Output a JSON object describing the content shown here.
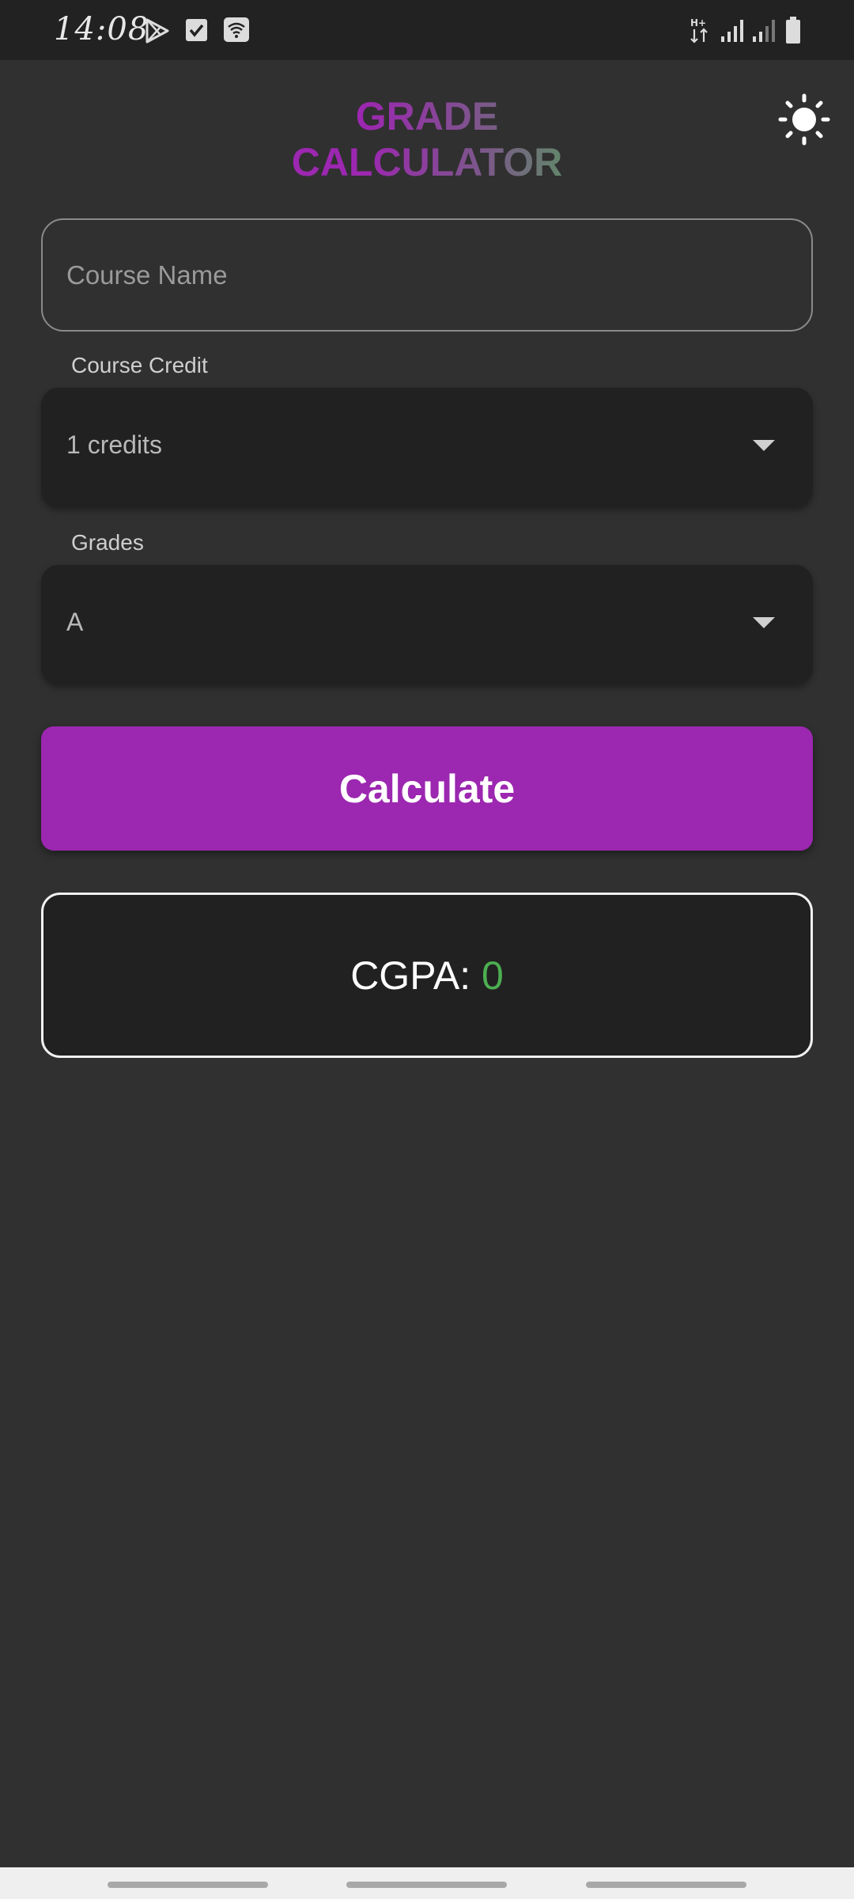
{
  "status_bar": {
    "time": "14:08",
    "left_icons": [
      "play-store-icon",
      "checkbox-icon",
      "wifi-icon"
    ],
    "right_icons": [
      "hplus-data-icon",
      "signal-icon",
      "signal-weak-icon",
      "battery-icon"
    ]
  },
  "header": {
    "title": "GRADE CALCULATOR",
    "theme_icon": "sun-icon"
  },
  "form": {
    "course_name_placeholder": "Course Name",
    "course_name_value": "",
    "credit_label": "Course Credit",
    "credit_selected": "1 credits",
    "grades_label": "Grades",
    "grade_selected": "A",
    "calculate_label": "Calculate"
  },
  "result": {
    "label": "CGPA: ",
    "value": "0"
  },
  "colors": {
    "accent_purple": "#9c27b0",
    "accent_green": "#4caf50",
    "background": "#303030",
    "surface": "#212121"
  }
}
